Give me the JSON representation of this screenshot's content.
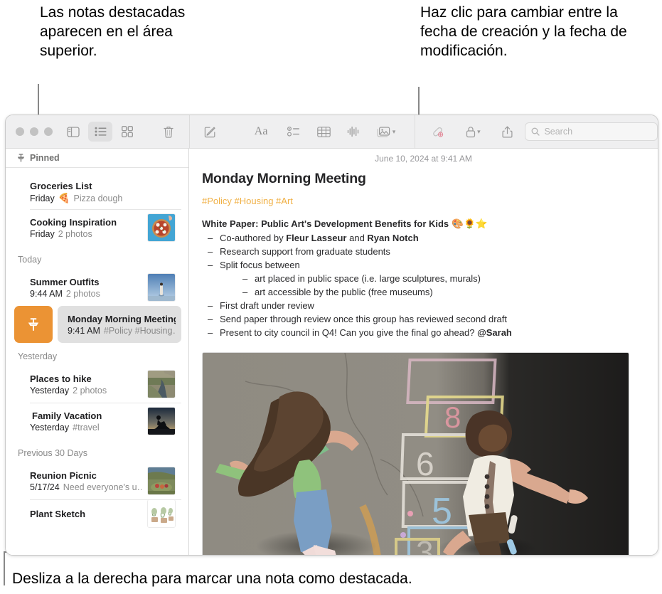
{
  "callouts": {
    "top_left": "Las notas destacadas aparecen en el área superior.",
    "top_right": "Haz clic para cambiar entre la fecha de creación y la fecha de modificación.",
    "bottom": "Desliza a la derecha para marcar una nota como destacada."
  },
  "toolbar": {
    "sidebar_toggle": "sidebar-toggle",
    "list_view": "list-view",
    "gallery_view": "gallery-view",
    "delete": "delete",
    "compose": "compose",
    "format": "Aa",
    "checklist": "checklist",
    "table": "table",
    "audio": "audio",
    "media": "media",
    "collaborate": "collaborate",
    "lock": "lock",
    "share": "share",
    "search_placeholder": "Search",
    "search_value": ""
  },
  "sidebar": {
    "pinned_header": "Pinned",
    "groups": [
      {
        "label": "",
        "notes": [
          {
            "title": "Groceries List",
            "when": "Friday",
            "preview": "Pizza dough",
            "emoji": "🍕",
            "thumb": "none",
            "shared": false,
            "first": true
          },
          {
            "title": "Cooking Inspiration",
            "when": "Friday",
            "preview": "2 photos",
            "emoji": "",
            "thumb": "pizza",
            "shared": false,
            "first": false
          }
        ]
      },
      {
        "label": "Today",
        "notes": [
          {
            "title": "Summer Outfits",
            "when": "9:44 AM",
            "preview": "2 photos",
            "emoji": "",
            "thumb": "person-sky",
            "shared": false,
            "first": true
          }
        ]
      },
      {
        "label": "Yesterday",
        "notes": [
          {
            "title": "Places to hike",
            "when": "Yesterday",
            "preview": "2 photos",
            "emoji": "",
            "thumb": "river",
            "shared": false,
            "first": true
          },
          {
            "title": "Family Vacation",
            "when": "Yesterday",
            "preview": "#travel",
            "emoji": "",
            "thumb": "bike-sunset",
            "shared": true,
            "first": false
          }
        ]
      },
      {
        "label": "Previous 30 Days",
        "notes": [
          {
            "title": "Reunion Picnic",
            "when": "5/17/24",
            "preview": "Need everyone's u…",
            "emoji": "",
            "thumb": "picnic",
            "shared": false,
            "first": true
          },
          {
            "title": "Plant Sketch",
            "when": "",
            "preview": "",
            "emoji": "",
            "thumb": "plants",
            "shared": false,
            "first": false
          }
        ]
      }
    ],
    "swiped_note": {
      "action_label": "pin",
      "title": "Monday Morning Meeting",
      "when": "9:41 AM",
      "preview": "#Policy #Housing…"
    }
  },
  "note": {
    "date": "June 10, 2024 at 9:41 AM",
    "title": "Monday Morning Meeting",
    "tags": "#Policy #Housing #Art",
    "heading": "White Paper: Public Art's Development Benefits for Kids",
    "heading_emoji": "🎨🌻⭐",
    "bullets": [
      {
        "text_parts": [
          "Co-authored by ",
          "Fleur Lasseur",
          " and ",
          "Ryan Notch"
        ],
        "bold": [
          false,
          true,
          false,
          true
        ],
        "children": []
      },
      {
        "text_parts": [
          "Research support from graduate students"
        ],
        "bold": [
          false
        ],
        "children": []
      },
      {
        "text_parts": [
          "Split focus between"
        ],
        "bold": [
          false
        ],
        "children": [
          "art placed in public space (i.e. large sculptures, murals)",
          "art accessible by the public (free museums)"
        ]
      },
      {
        "text_parts": [
          "First draft under review"
        ],
        "bold": [
          false
        ],
        "children": []
      },
      {
        "text_parts": [
          "Send paper through review once this group has reviewed second draft"
        ],
        "bold": [
          false
        ],
        "children": []
      },
      {
        "text_parts": [
          "Present to city council in Q4! Can you give the final go ahead? ",
          "@Sarah"
        ],
        "bold": [
          false,
          true
        ],
        "children": []
      }
    ],
    "photo_alt": "Two children playing hopscotch on chalk-drawn pavement"
  },
  "colors": {
    "pin_action": "#eb9334",
    "tag": "#f0b045",
    "selected_row": "#e0e0e0",
    "toolbar_bg": "#efeff0"
  }
}
